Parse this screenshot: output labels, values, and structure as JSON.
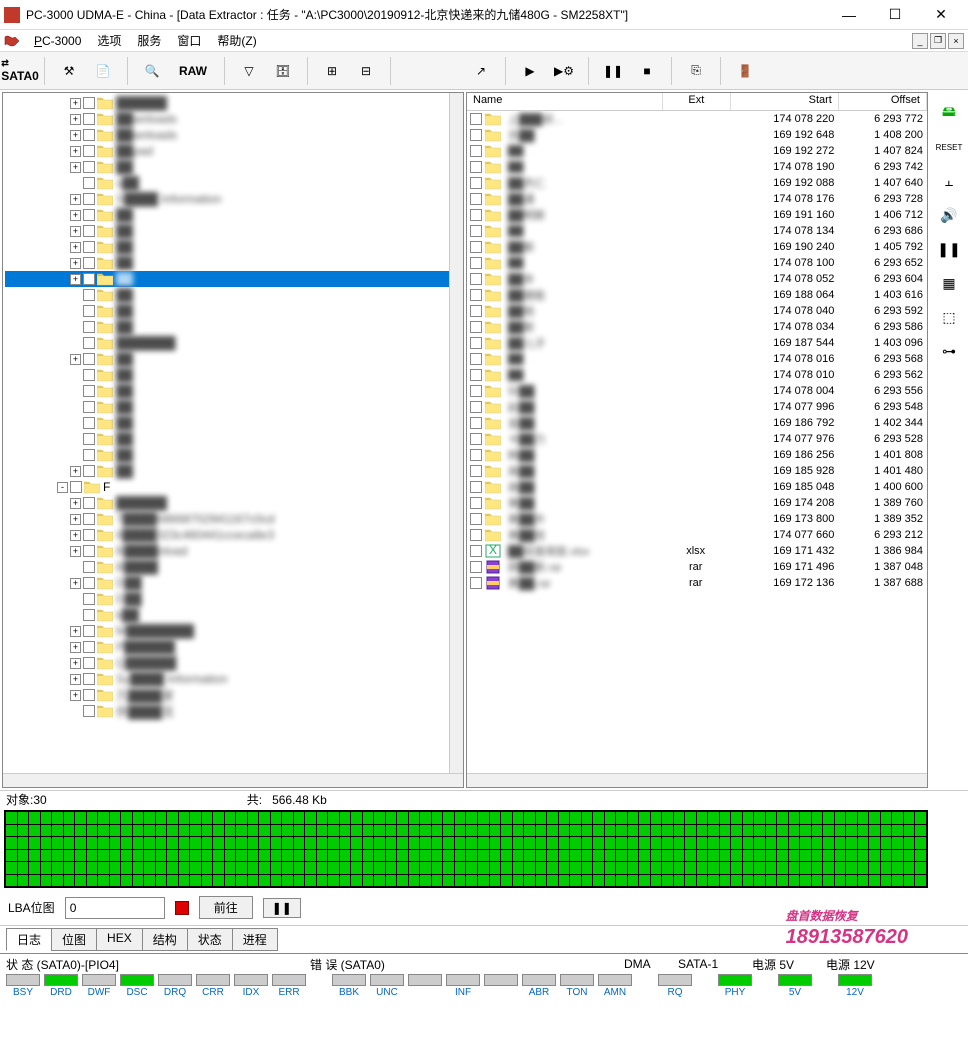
{
  "window": {
    "title": "PC-3000 UDMA-E - China - [Data Extractor : 任务 - \"A:\\PC3000\\20190912-北京快递来的九储480G - SM2258XT\"]"
  },
  "menu": {
    "items": [
      "PC-3000",
      "选项",
      "服务",
      "窗口",
      "帮助(Z)"
    ]
  },
  "toolbar": {
    "sata": "SATA0",
    "raw": "RAW"
  },
  "tree": {
    "items": [
      {
        "indent": 5,
        "exp": "+",
        "label": "██████",
        "clear": false
      },
      {
        "indent": 5,
        "exp": "+",
        "label": "██wnloads",
        "clear": false
      },
      {
        "indent": 5,
        "exp": "+",
        "label": "██wnloads",
        "clear": false
      },
      {
        "indent": 5,
        "exp": "+",
        "label": "██pad",
        "clear": false
      },
      {
        "indent": 5,
        "exp": "+",
        "label": "██",
        "clear": false
      },
      {
        "indent": 5,
        "exp": "",
        "label": "s██",
        "clear": false
      },
      {
        "indent": 5,
        "exp": "+",
        "label": "S████ Information",
        "clear": false
      },
      {
        "indent": 5,
        "exp": "+",
        "label": "██",
        "clear": false
      },
      {
        "indent": 5,
        "exp": "+",
        "label": "██",
        "clear": false
      },
      {
        "indent": 5,
        "exp": "+",
        "label": "██",
        "clear": false
      },
      {
        "indent": 5,
        "exp": "+",
        "label": "██",
        "clear": false
      },
      {
        "indent": 5,
        "exp": "+",
        "label": "██",
        "clear": false,
        "selected": true
      },
      {
        "indent": 5,
        "exp": "",
        "label": "██",
        "clear": false
      },
      {
        "indent": 5,
        "exp": "",
        "label": "██",
        "clear": false
      },
      {
        "indent": 5,
        "exp": "",
        "label": "██",
        "clear": false
      },
      {
        "indent": 5,
        "exp": "",
        "label": "███████",
        "clear": false
      },
      {
        "indent": 5,
        "exp": "+",
        "label": "██",
        "clear": false
      },
      {
        "indent": 5,
        "exp": "",
        "label": "██",
        "clear": false
      },
      {
        "indent": 5,
        "exp": "",
        "label": "██",
        "clear": false
      },
      {
        "indent": 5,
        "exp": "",
        "label": "██",
        "clear": false
      },
      {
        "indent": 5,
        "exp": "",
        "label": "██",
        "clear": false
      },
      {
        "indent": 5,
        "exp": "",
        "label": "██",
        "clear": false
      },
      {
        "indent": 5,
        "exp": "",
        "label": "██",
        "clear": false
      },
      {
        "indent": 5,
        "exp": "+",
        "label": "██",
        "clear": false
      },
      {
        "indent": 4,
        "exp": "-",
        "label": "F",
        "clear": true
      },
      {
        "indent": 5,
        "exp": "+",
        "label": "██████",
        "clear": false
      },
      {
        "indent": 5,
        "exp": "+",
        "label": "7████68668702941167c0cd",
        "clear": false
      },
      {
        "indent": 5,
        "exp": "+",
        "label": "8████323c460441cceca8e3",
        "clear": false
      },
      {
        "indent": 5,
        "exp": "+",
        "label": "B████nload",
        "clear": false
      },
      {
        "indent": 5,
        "exp": "",
        "label": "B████",
        "clear": false
      },
      {
        "indent": 5,
        "exp": "+",
        "label": "D██",
        "clear": false
      },
      {
        "indent": 5,
        "exp": "",
        "label": "D██",
        "clear": false
      },
      {
        "indent": 5,
        "exp": "",
        "label": "k██",
        "clear": false
      },
      {
        "indent": 5,
        "exp": "+",
        "label": "M████████",
        "clear": false
      },
      {
        "indent": 5,
        "exp": "+",
        "label": "P██████",
        "clear": false
      },
      {
        "indent": 5,
        "exp": "+",
        "label": "Q██████",
        "clear": false
      },
      {
        "indent": 5,
        "exp": "+",
        "label": "Sy████ Information",
        "clear": false
      },
      {
        "indent": 5,
        "exp": "+",
        "label": "万████家",
        "clear": false
      },
      {
        "indent": 5,
        "exp": "",
        "label": "供████览",
        "clear": false
      }
    ]
  },
  "list": {
    "headers": {
      "name": "Name",
      "ext": "Ext",
      "start": "Start",
      "offset": "Offset"
    },
    "rows": [
      {
        "icon": "folder",
        "name": "上███研...",
        "ext": "",
        "start": "174 078 220",
        "offset": "6 293 772"
      },
      {
        "icon": "folder",
        "name": "京██",
        "ext": "",
        "start": "169 192 648",
        "offset": "1 408 200"
      },
      {
        "icon": "folder",
        "name": "██",
        "ext": "",
        "start": "169 192 272",
        "offset": "1 407 824"
      },
      {
        "icon": "folder",
        "name": "██",
        "ext": "",
        "start": "174 078 190",
        "offset": "6 293 742"
      },
      {
        "icon": "folder",
        "name": "██杰仁",
        "ext": "",
        "start": "169 192 088",
        "offset": "1 407 640"
      },
      {
        "icon": "folder",
        "name": "██通",
        "ext": "",
        "start": "174 078 176",
        "offset": "6 293 728"
      },
      {
        "icon": "folder",
        "name": "██明斯",
        "ext": "",
        "start": "169 191 160",
        "offset": "1 406 712"
      },
      {
        "icon": "folder",
        "name": "██",
        "ext": "",
        "start": "174 078 134",
        "offset": "6 293 686"
      },
      {
        "icon": "folder",
        "name": "██斯",
        "ext": "",
        "start": "169 190 240",
        "offset": "1 405 792"
      },
      {
        "icon": "folder",
        "name": "██",
        "ext": "",
        "start": "174 078 100",
        "offset": "6 293 652"
      },
      {
        "icon": "folder",
        "name": "██丰",
        "ext": "",
        "start": "174 078 052",
        "offset": "6 293 604"
      },
      {
        "icon": "folder",
        "name": "██捷能",
        "ext": "",
        "start": "169 188 064",
        "offset": "1 403 616"
      },
      {
        "icon": "folder",
        "name": "██锐",
        "ext": "",
        "start": "174 078 040",
        "offset": "6 293 592"
      },
      {
        "icon": "folder",
        "name": "██斯",
        "ext": "",
        "start": "174 078 034",
        "offset": "6 293 586"
      },
      {
        "icon": "folder",
        "name": "██儿子",
        "ext": "",
        "start": "169 187 544",
        "offset": "1 403 096"
      },
      {
        "icon": "folder",
        "name": "██",
        "ext": "",
        "start": "174 078 016",
        "offset": "6 293 568"
      },
      {
        "icon": "folder",
        "name": "██",
        "ext": "",
        "start": "174 078 010",
        "offset": "6 293 562"
      },
      {
        "icon": "folder",
        "name": "珍██",
        "ext": "",
        "start": "174 078 004",
        "offset": "6 293 556"
      },
      {
        "icon": "folder",
        "name": "赵██",
        "ext": "",
        "start": "174 077 996",
        "offset": "6 293 548"
      },
      {
        "icon": "folder",
        "name": "金██",
        "ext": "",
        "start": "169 186 792",
        "offset": "1 402 344"
      },
      {
        "icon": "folder",
        "name": "卡██力",
        "ext": "",
        "start": "174 077 976",
        "offset": "6 293 528"
      },
      {
        "icon": "folder",
        "name": "韩██",
        "ext": "",
        "start": "169 186 256",
        "offset": "1 401 808"
      },
      {
        "icon": "folder",
        "name": "高██",
        "ext": "",
        "start": "169 185 928",
        "offset": "1 401 480"
      },
      {
        "icon": "folder",
        "name": "高██",
        "ext": "",
        "start": "169 185 048",
        "offset": "1 400 600"
      },
      {
        "icon": "folder",
        "name": "黄██",
        "ext": "",
        "start": "169 174 208",
        "offset": "1 389 760"
      },
      {
        "icon": "folder",
        "name": "黄██外",
        "ext": "",
        "start": "169 173 800",
        "offset": "1 389 352"
      },
      {
        "icon": "folder",
        "name": "黄██技",
        "ext": "",
        "start": "174 077 660",
        "offset": "6 293 212"
      },
      {
        "icon": "xlsx",
        "name": "██双面背胶.xlsx",
        "ext": "xlsx",
        "start": "169 171 432",
        "offset": "1 386 984"
      },
      {
        "icon": "rar",
        "name": "顾██斯.rar",
        "ext": "rar",
        "start": "169 171 496",
        "offset": "1 387 048"
      },
      {
        "icon": "rar",
        "name": "黄██.rar",
        "ext": "rar",
        "start": "169 172 136",
        "offset": "1 387 688"
      }
    ]
  },
  "status": {
    "objects_label": "对象:",
    "objects_count": "30",
    "total_label": "共:",
    "total_size": "566.48 Kb"
  },
  "lba": {
    "label": "LBA位图",
    "value": "0",
    "go": "前往"
  },
  "tabs": [
    "日志",
    "位图",
    "HEX",
    "结构",
    "状态",
    "进程"
  ],
  "footer": {
    "status_label": "状 态 (SATA0)-[PIO4]",
    "error_label": "错 误 (SATA0)",
    "dma_label": "DMA",
    "sata1_label": "SATA-1",
    "p5_label": "电源 5V",
    "p12_label": "电源 12V",
    "leds1": [
      "BSY",
      "DRD",
      "DWF",
      "DSC",
      "DRQ",
      "CRR",
      "IDX",
      "ERR"
    ],
    "leds2": [
      "BBK",
      "UNC",
      "",
      "INF",
      "",
      "ABR",
      "TON",
      "AMN"
    ],
    "leds3": [
      "RQ"
    ],
    "leds4": [
      "PHY"
    ],
    "leds5": [
      "5V"
    ],
    "leds6": [
      "12V"
    ]
  },
  "watermark": {
    "text": "盘首数据恢复",
    "phone": "18913587620"
  }
}
